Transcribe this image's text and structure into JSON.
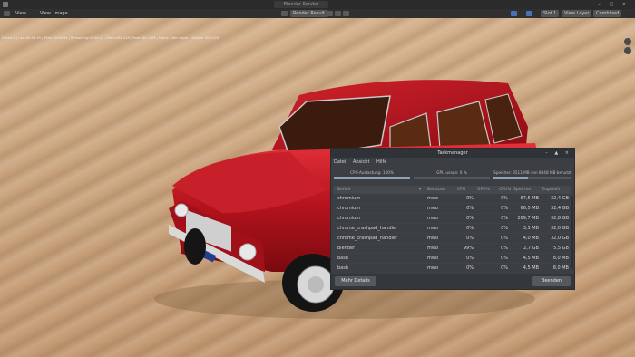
{
  "window": {
    "title": "Blender Render"
  },
  "header": {
    "menus": [
      "View",
      "View",
      "Image"
    ],
    "render_result": "Render Result",
    "slot": "Slot 1",
    "view_layer": "View Layer",
    "combined": "Combined"
  },
  "status_line": "Frame:1 | Last:00:35.45 | Time:00:48.44 | Remaining:00:36.23 | Mem:487.41M, Peak:487.41M | Scene, Main Layer | Sample 300/128",
  "taskmanager": {
    "title": "Taskmanager",
    "menu": [
      "Datei",
      "Ansicht",
      "Hilfe"
    ],
    "cpu_label": "CPU-Auslastung: 100%",
    "cpu_fraction": 1.0,
    "gpu_label": "GPU usage: 0 %",
    "gpu_fraction": 0.0,
    "mem_label": "Speicher: 3511 MB von 8048 MB benutzt",
    "mem_fraction": 0.44,
    "columns": [
      "Befehl",
      "Benutzer",
      "CPU",
      "GPU%",
      "CPU%",
      "Speicher",
      "Zugeteilt"
    ],
    "rows": [
      {
        "name": "chromium",
        "user": "mwo",
        "cpu": "0%",
        "gpu": "",
        "cpu2": "0%",
        "mem": "67,5 MB",
        "alloc": "32,4 GB"
      },
      {
        "name": "chromium",
        "user": "mwo",
        "cpu": "0%",
        "gpu": "",
        "cpu2": "0%",
        "mem": "66,5 MB",
        "alloc": "32,4 GB"
      },
      {
        "name": "chromium",
        "user": "mwo",
        "cpu": "0%",
        "gpu": "",
        "cpu2": "0%",
        "mem": "269,7 MB",
        "alloc": "32,8 GB"
      },
      {
        "name": "chrome_crashpad_handler",
        "user": "mwo",
        "cpu": "0%",
        "gpu": "",
        "cpu2": "0%",
        "mem": "3,5 MB",
        "alloc": "32,0 GB"
      },
      {
        "name": "chrome_crashpad_handler",
        "user": "mwo",
        "cpu": "0%",
        "gpu": "",
        "cpu2": "0%",
        "mem": "4,0 MB",
        "alloc": "32,0 GB"
      },
      {
        "name": "blender",
        "user": "mwo",
        "cpu": "99%",
        "gpu": "",
        "cpu2": "0%",
        "mem": "2,7 GB",
        "alloc": "5,5 GB"
      },
      {
        "name": "bash",
        "user": "mwo",
        "cpu": "0%",
        "gpu": "",
        "cpu2": "0%",
        "mem": "4,5 MB",
        "alloc": "8,0 MB"
      },
      {
        "name": "bash",
        "user": "mwo",
        "cpu": "0%",
        "gpu": "",
        "cpu2": "0%",
        "mem": "4,5 MB",
        "alloc": "8,0 MB"
      }
    ],
    "more_details": "Mehr Details",
    "end_button": "Beenden"
  }
}
